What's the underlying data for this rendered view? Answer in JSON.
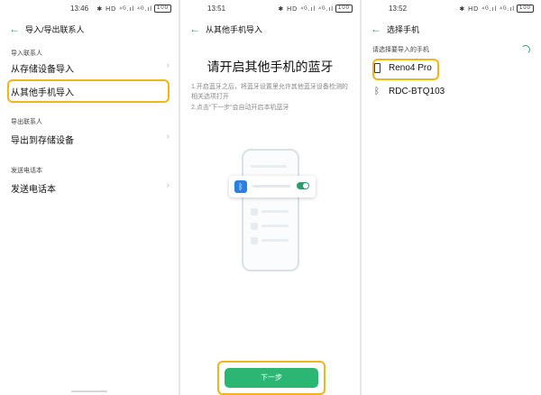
{
  "panel1": {
    "time": "13:46",
    "status_icons": "✱ HD ⁴ᴳ.ıl ⁴ᴳ.ıl",
    "battery": "100",
    "title": "导入/导出联系人",
    "section_import": "导入联系人",
    "import_storage": "从存储设备导入",
    "import_other_phone": "从其他手机导入",
    "section_export": "导出联系人",
    "export_storage": "导出到存储设备",
    "section_send": "发送电话本",
    "send_contacts": "发送电话本"
  },
  "panel2": {
    "time": "13:51",
    "status_icons": "✱ HD ⁴ᴳ.ıl ⁴ᴳ.ıl",
    "battery": "100",
    "title": "从其他手机导入",
    "heading": "请开启其他手机的蓝牙",
    "instruction_1": "1.开启蓝牙之后，将蓝牙设置里允许其他蓝牙设备检测的相关选项打开",
    "instruction_2": "2.点击“下一步”会自动开启本机蓝牙",
    "next_button": "下一步"
  },
  "panel3": {
    "time": "13:52",
    "status_icons": "✱ HD ⁴ᴳ.ıl ⁴ᴳ.ıl",
    "battery": "100",
    "title": "选择手机",
    "prompt": "请选择要导入的手机",
    "devices": [
      {
        "name": "Reno4 Pro",
        "icon": "phone-icon"
      },
      {
        "name": "RDC-BTQ103",
        "icon": "bluetooth-icon"
      }
    ]
  },
  "colors": {
    "accent": "#2a9d6a",
    "highlight": "#f2b51a",
    "button": "#2bb673",
    "bluetooth": "#2a7fe0"
  }
}
